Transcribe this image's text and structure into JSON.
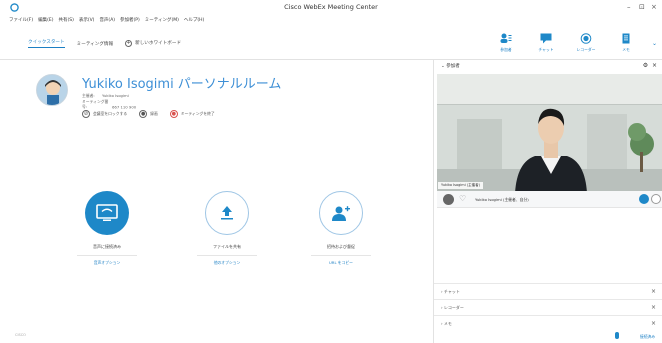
{
  "window": {
    "title": "Cisco WebEx Meeting Center",
    "controls": [
      "–",
      "⊡",
      "×"
    ]
  },
  "menu": [
    "ファイル(F)",
    "編集(E)",
    "共有(S)",
    "表示(V)",
    "音声(A)",
    "参加者(P)",
    "ミーティング(M)",
    "ヘルプ(H)"
  ],
  "tabs": {
    "quickstart": "クイックスタート",
    "meeting_info": "ミーティング情報",
    "new_whiteboard": "新しいホワイトボード"
  },
  "toolbar_buttons": [
    {
      "label": "参加者",
      "icon": "participants-icon"
    },
    {
      "label": "チャット",
      "icon": "chat-icon"
    },
    {
      "label": "レコーダー",
      "icon": "recorder-icon"
    },
    {
      "label": "メモ",
      "icon": "notes-icon"
    }
  ],
  "room": {
    "title": "Yukiko Isogimi パーソナルルーム",
    "host_label": "主催者:",
    "host_value": "Yukiko Isogimi",
    "number_label": "ミーティング番号:",
    "number_value": "667 110 900",
    "actions": {
      "lock": "会議室をロックする",
      "record": "録画",
      "end": "ミーティングを終了"
    }
  },
  "big_actions": [
    {
      "label": "音声に接続済み",
      "sub": "音声オプション"
    },
    {
      "label": "ファイルを共有",
      "sub": "他のオプション"
    },
    {
      "label": "招待および督促",
      "sub": "URL をコピー"
    }
  ],
  "footer_left": "CISCO",
  "panel": {
    "title": "参加者",
    "video_name": "Yukiko Isogimi (主催者)",
    "participant": "Yukiko Isogimi (主催者、自分)",
    "sections": [
      "チャット",
      "レコーダー",
      "メモ"
    ],
    "footer": "接続済み"
  },
  "colors": {
    "accent": "#1e88c8",
    "title_blue": "#3d8fd6",
    "end_red": "#d9534f"
  }
}
